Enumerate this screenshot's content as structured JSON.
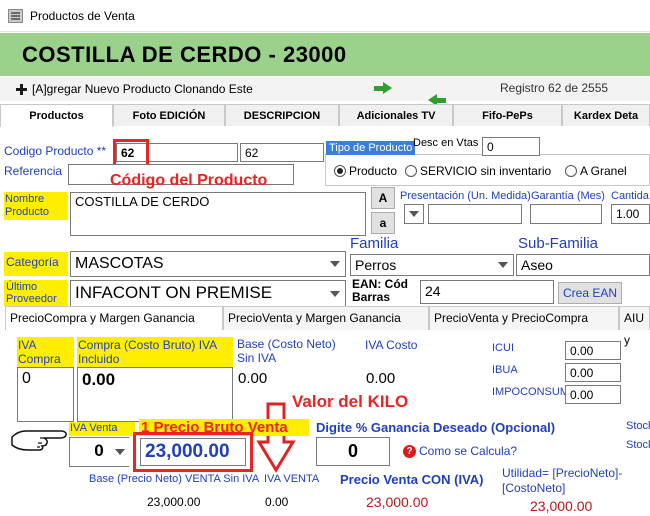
{
  "window": {
    "title": "Productos de Venta"
  },
  "header": {
    "product_title": "COSTILLA DE CERDO - 23000"
  },
  "toolbar": {
    "clone_label": "[A]gregar Nuevo Producto Clonando Este",
    "registro": "Registro 62 de 2555"
  },
  "tabs": [
    "Productos",
    "Foto EDICIÓN",
    "DESCRIPCION",
    "Adicionales TV",
    "Fifo-PePs",
    "Kardex Deta"
  ],
  "form": {
    "codigo_label": "Codigo Producto **",
    "codigo_value": "62",
    "codigo_value2": "62",
    "referencia_label": "Referencia",
    "nombre_label": "Nombre Producto",
    "nombre_value": "COSTILLA DE CERDO",
    "btn_A": "A",
    "btn_a": "a",
    "desc_vtas_label": "Desc en Vtas",
    "desc_vtas_value": "0",
    "tipo_title": "Tipo de Producto",
    "tipo_options": [
      "Producto",
      "SERVICIO sin inventario",
      "A Granel"
    ],
    "presentacion_label": "Presentación (Un. Medida)",
    "garantia_label": "Garantía (Mes)",
    "cantidad_label": "Cantida",
    "cantidad_value": "1.00",
    "categoria_label": "Categoría",
    "categoria_value": "MASCOTAS",
    "familia_label": "Familia",
    "familia_value": "Perros",
    "subfamilia_label": "Sub-Familia",
    "subfamilia_value": "Aseo",
    "proveedor_label": "Último Proveedor",
    "proveedor_value": "INFACONT ON PREMISE",
    "ean_label": "EAN: Cód Barras",
    "ean_value": "24",
    "crea_ean": "Crea EAN"
  },
  "subtabs": [
    "PrecioCompra y Margen Ganancia",
    "PrecioVenta y Margen Ganancia",
    "PrecioVenta y PrecioCompra",
    "AIU y"
  ],
  "pricing": {
    "iva_compra_label": "IVA Compra",
    "iva_compra_value": "0",
    "compra_label": "Compra (Costo Bruto) IVA Incluido",
    "compra_value": "0.00",
    "base_label": "Base (Costo Neto) Sin IVA",
    "base_value": "0.00",
    "iva_costo_label": "IVA Costo",
    "iva_costo_value": "0.00",
    "icui_label": "ICUI",
    "icui_value": "0.00",
    "ibua_label": "IBUA",
    "ibua_value": "0.00",
    "impo_label": "IMPOCONSUMO",
    "impo_value": "0.00",
    "iva_venta_label": "IVA Venta",
    "iva_venta_value": "0",
    "precio_bruto_label": "1 Precio Bruto Venta",
    "precio_bruto_value": "23,000.00",
    "ganancia_label": "Digite % Ganancia Deseado (Opcional)",
    "ganancia_value": "0",
    "como_calcula": "Como se Calcula?",
    "stock1": "Stock",
    "stock2": "Stock",
    "base_venta_label": "Base (Precio Neto) VENTA Sin IVA",
    "base_venta_value": "23,000.00",
    "iva_venta2_label": "IVA VENTA",
    "iva_venta2_value": "0.00",
    "precio_con_iva_label": "Precio Venta CON (IVA)",
    "precio_con_iva_value": "23,000.00",
    "utilidad_label": "Utilidad= [PrecioNeto]-[CostoNeto]",
    "utilidad_value": "23,000.00"
  },
  "annotations": {
    "codigo_producto": "Código del Producto",
    "valor_kilo": "Valor del KILO"
  },
  "colors": {
    "header_green": "#9ad18b",
    "highlight_yellow": "#ffee00",
    "annotation_red": "#e22222",
    "link_blue": "#1f3fbf"
  }
}
